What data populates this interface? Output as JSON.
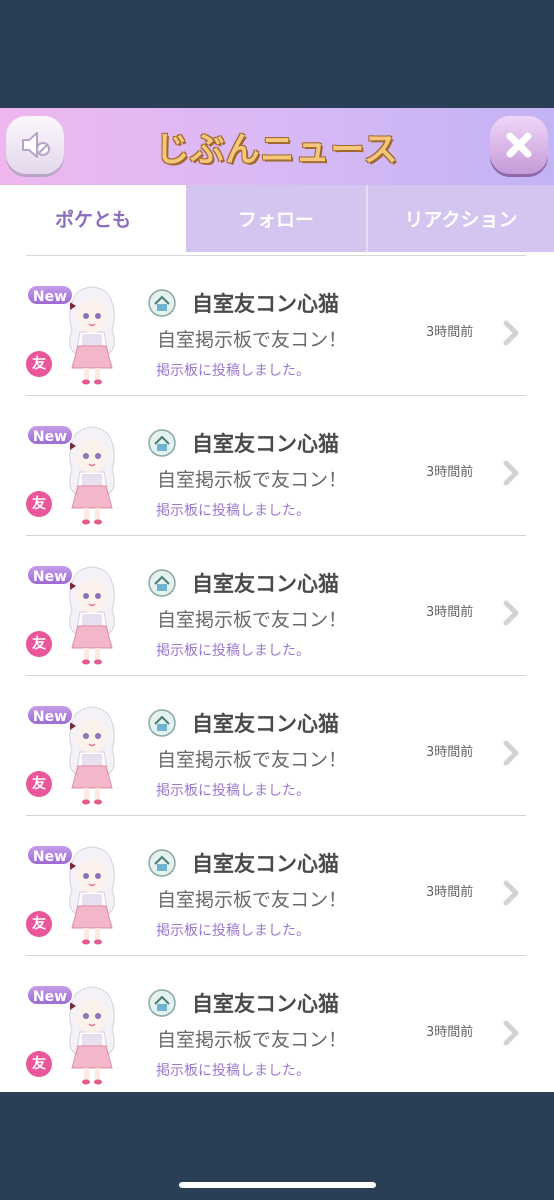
{
  "header": {
    "title": "じぶんニュース",
    "sound_icon": "speaker-muted-icon",
    "close_icon": "close-x-icon"
  },
  "tabs": [
    {
      "label": "ポケとも",
      "active": true
    },
    {
      "label": "フォロー",
      "active": false
    },
    {
      "label": "リアクション",
      "active": false
    }
  ],
  "news": [
    {
      "badge": "New",
      "friend": "友",
      "name": "自室友コン心猫",
      "subtitle": "自室掲示板で友コン！",
      "message": "掲示板に投稿しました。",
      "time": "3時間前"
    },
    {
      "badge": "New",
      "friend": "友",
      "name": "自室友コン心猫",
      "subtitle": "自室掲示板で友コン！",
      "message": "掲示板に投稿しました。",
      "time": "3時間前"
    },
    {
      "badge": "New",
      "friend": "友",
      "name": "自室友コン心猫",
      "subtitle": "自室掲示板で友コン！",
      "message": "掲示板に投稿しました。",
      "time": "3時間前"
    },
    {
      "badge": "New",
      "friend": "友",
      "name": "自室友コン心猫",
      "subtitle": "自室掲示板で友コン！",
      "message": "掲示板に投稿しました。",
      "time": "3時間前"
    },
    {
      "badge": "New",
      "friend": "友",
      "name": "自室友コン心猫",
      "subtitle": "自室掲示板で友コン！",
      "message": "掲示板に投稿しました。",
      "time": "3時間前"
    },
    {
      "badge": "New",
      "friend": "友",
      "name": "自室友コン心猫",
      "subtitle": "自室掲示板で友コン！",
      "message": "掲示板に投稿しました。",
      "time": "3時間前"
    }
  ],
  "colors": {
    "background": "#2a3e55",
    "header_gradient_start": "#efb7f0",
    "header_gradient_end": "#c3b3f4",
    "title_fill": "#f4c77a",
    "active_tab_text": "#8a6cbc",
    "inactive_tab_bg": "#d3c5ef",
    "new_badge": "#9a6bd2",
    "friend_badge": "#e9579a",
    "message_text": "#9a78cf"
  }
}
